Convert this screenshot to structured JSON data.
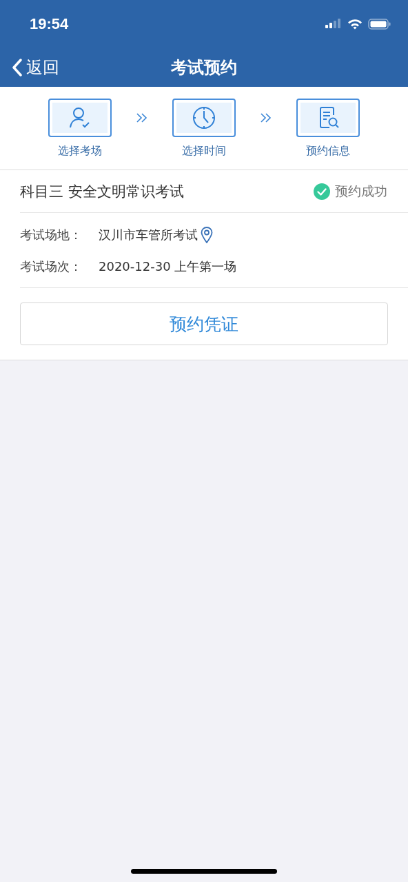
{
  "status_bar": {
    "time": "19:54"
  },
  "nav": {
    "back": "返回",
    "title": "考试预约"
  },
  "steps": [
    {
      "label": "选择考场",
      "kind": "person"
    },
    {
      "label": "选择时间",
      "kind": "clock"
    },
    {
      "label": "预约信息",
      "kind": "document"
    }
  ],
  "exam": {
    "title": "科目三 安全文明常识考试",
    "status": {
      "label": "预约成功",
      "kind": "success"
    },
    "rows": [
      {
        "label": "考试场地：",
        "value": "汉川市车管所考试",
        "kind": "location"
      },
      {
        "label": "考试场次：",
        "value": "2020-12-30 上午第一场",
        "kind": "plain"
      }
    ],
    "button": "预约凭证"
  }
}
